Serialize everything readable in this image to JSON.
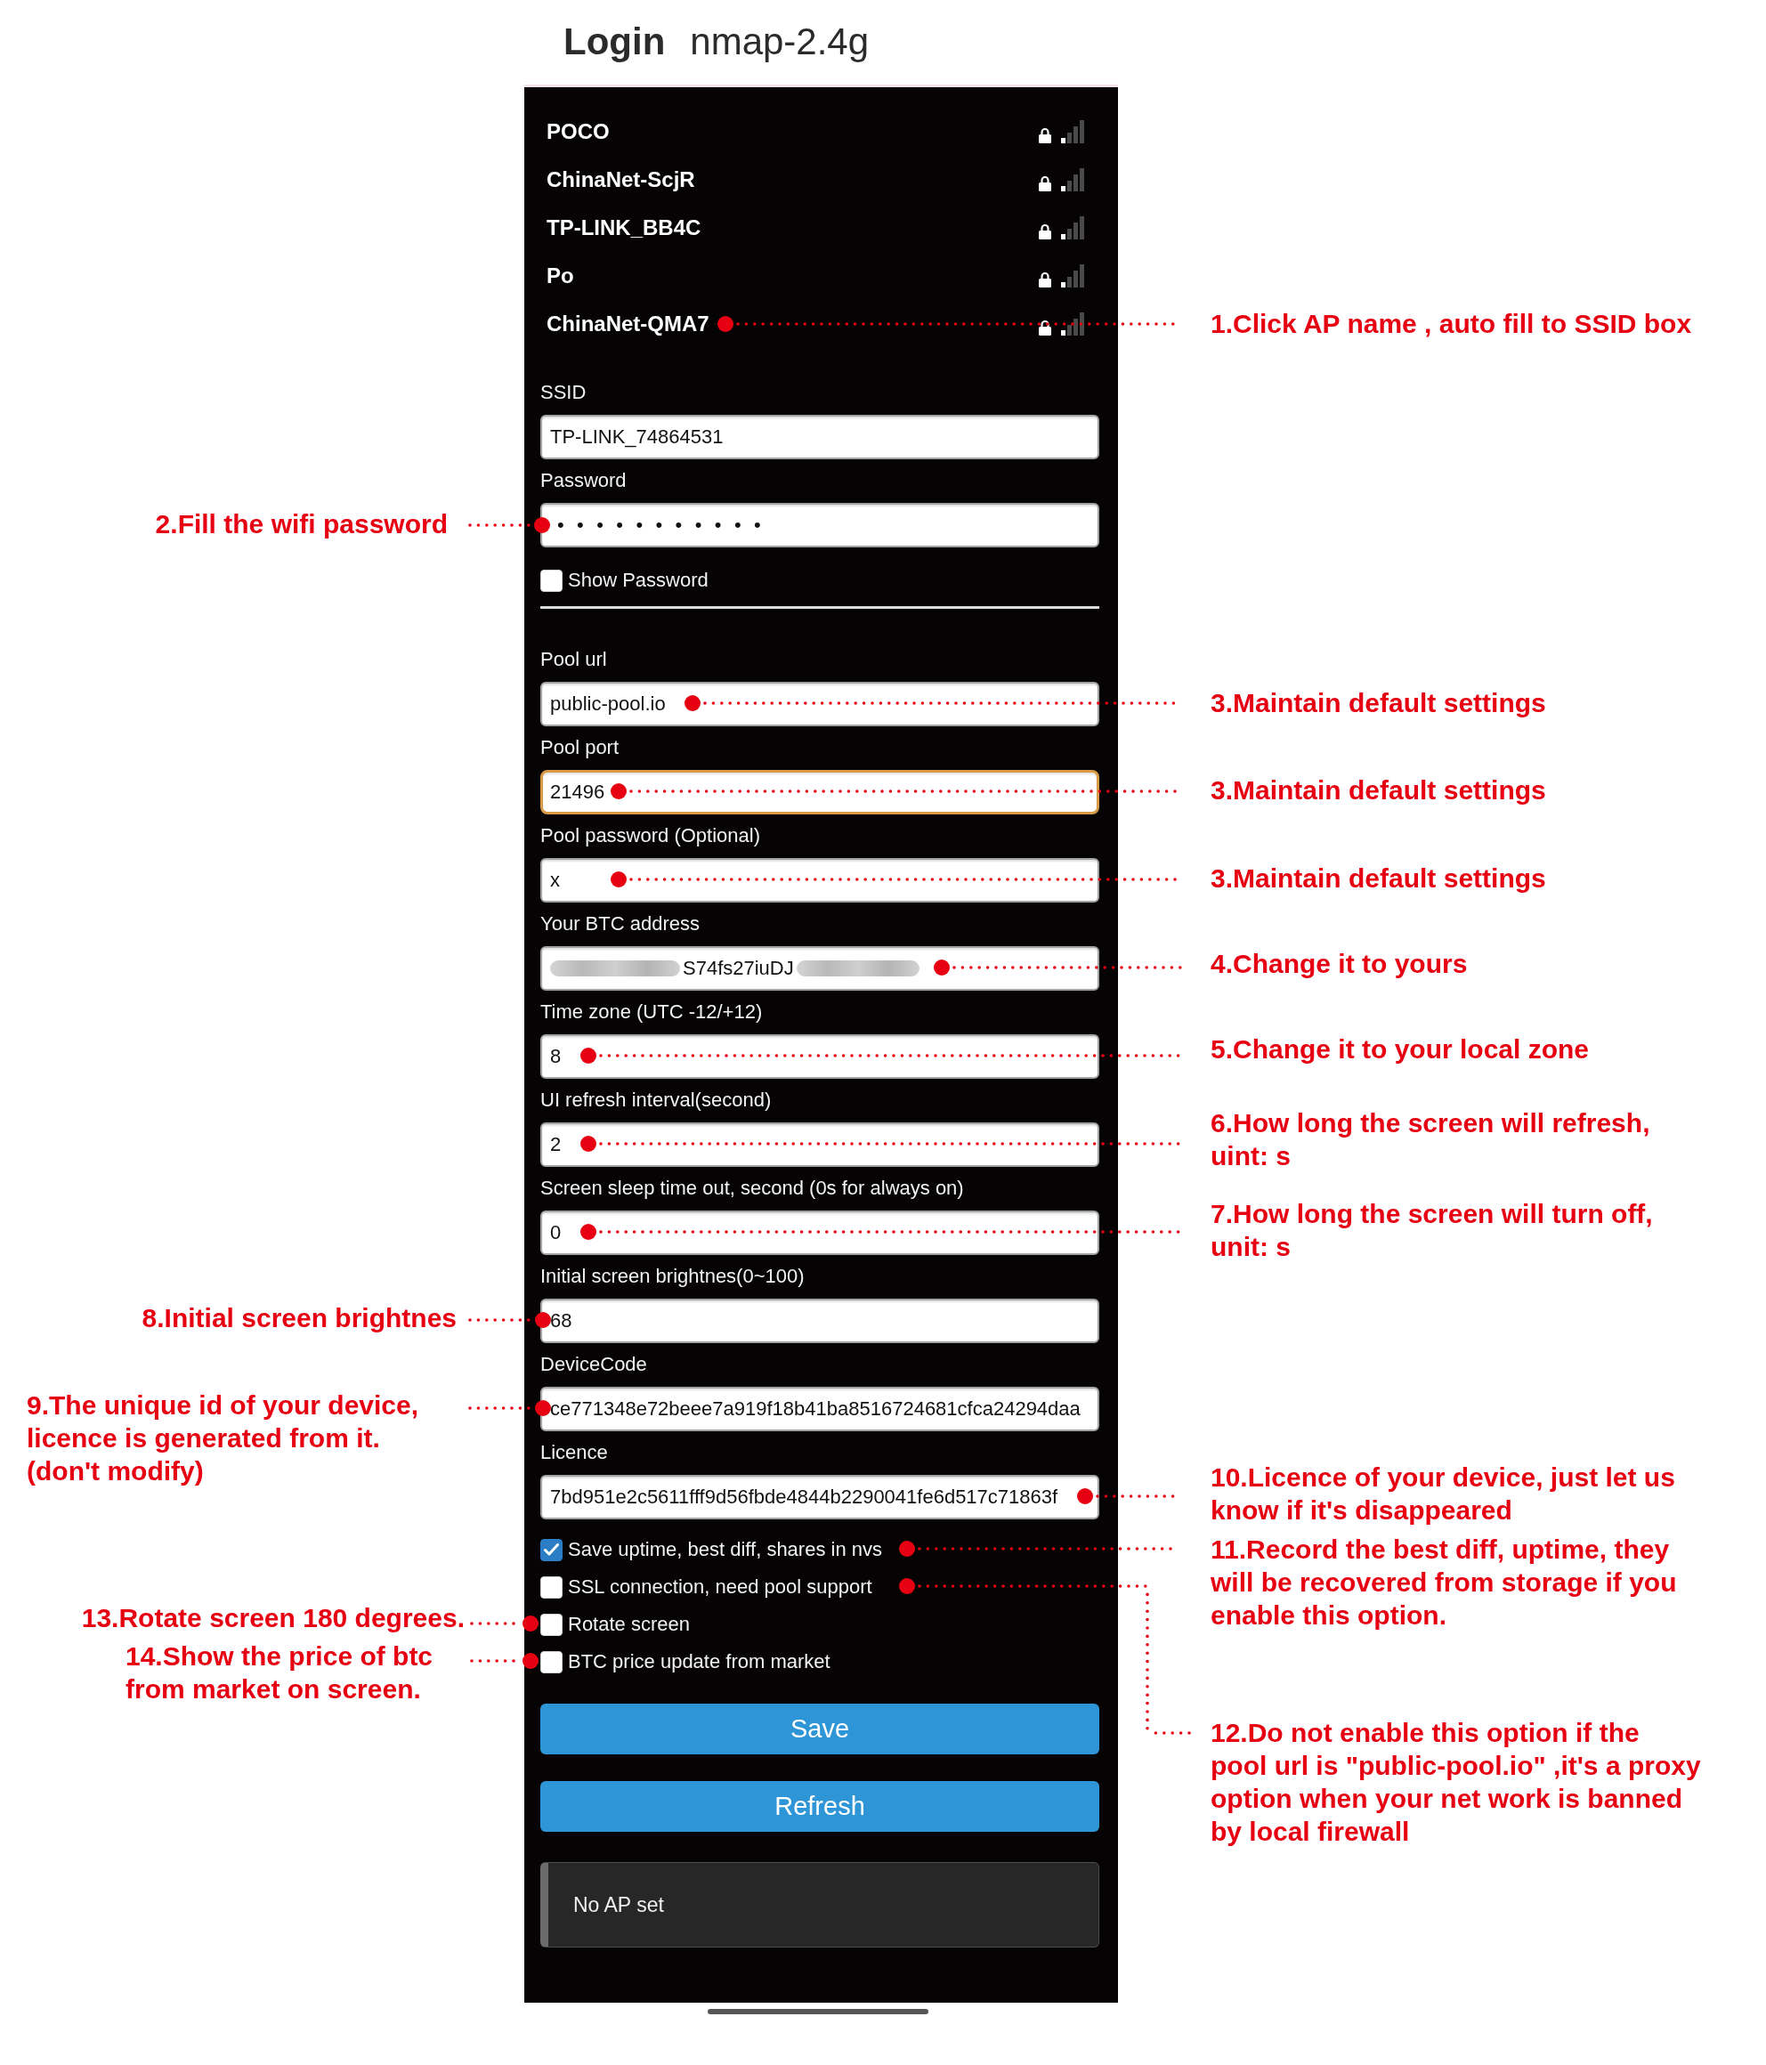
{
  "header": {
    "title": "Login",
    "subtitle": "nmap-2.4g"
  },
  "networks": [
    {
      "name": "POCO",
      "secured": true
    },
    {
      "name": "ChinaNet-ScjR",
      "secured": true
    },
    {
      "name": "TP-LINK_BB4C",
      "secured": true
    },
    {
      "name": "Po",
      "secured": true
    },
    {
      "name": "ChinaNet-QMA7",
      "secured": true
    }
  ],
  "wifi_fields": [
    {
      "label": "SSID",
      "kind": "text",
      "value": "TP-LINK_74864531",
      "focused": false
    },
    {
      "label": "Password",
      "kind": "password",
      "value": "•••••••••••",
      "focused": false
    }
  ],
  "show_password": {
    "label": "Show Password",
    "checked": false
  },
  "settings_fields": [
    {
      "label": "Pool url",
      "kind": "text",
      "value": "public-pool.io",
      "focused": false
    },
    {
      "label": "Pool port",
      "kind": "text",
      "value": "21496",
      "focused": true
    },
    {
      "label": "Pool password (Optional)",
      "kind": "text",
      "value": "x",
      "focused": false
    },
    {
      "label": "Your BTC address",
      "kind": "blurred",
      "value": "S74fs27iuDJ",
      "focused": false
    },
    {
      "label": "Time zone (UTC -12/+12)",
      "kind": "text",
      "value": "8",
      "focused": false
    },
    {
      "label": "UI refresh interval(second)",
      "kind": "text",
      "value": "2",
      "focused": false
    },
    {
      "label": "Screen sleep time out, second (0s for always on)",
      "kind": "text",
      "value": "0",
      "focused": false
    },
    {
      "label": "Initial screen brightnes(0~100)",
      "kind": "text",
      "value": "68",
      "focused": false
    },
    {
      "label": "DeviceCode",
      "kind": "text",
      "value": "ce771348e72beee7a919f18b41ba8516724681cfca24294daa",
      "focused": false
    },
    {
      "label": "Licence",
      "kind": "text",
      "value": "7bd951e2c5611fff9d56fbde4844b2290041fe6d517c71863f",
      "focused": false
    }
  ],
  "options": [
    {
      "label": "Save uptime, best diff, shares in nvs",
      "checked": true
    },
    {
      "label": "SSL connection, need pool support",
      "checked": false
    },
    {
      "label": "Rotate screen",
      "checked": false
    },
    {
      "label": "BTC price update from market",
      "checked": false
    }
  ],
  "buttons": [
    "Save",
    "Refresh"
  ],
  "status": "No AP set",
  "annotations": [
    "1.Click AP name , auto fill to SSID box",
    "2.Fill the wifi password",
    "3.Maintain default settings",
    "3.Maintain default settings",
    "3.Maintain default settings",
    "4.Change it to yours",
    "5.Change it to your local zone",
    "6.How long the screen will refresh,\nuint: s",
    "7.How long the screen will turn off,\nunit: s",
    "8.Initial screen brightnes",
    "9.The unique id of your device,\nlicence is generated from it.\n(don't modify)",
    "10.Licence of your device, just let us\nknow if it's disappeared",
    "11.Record the best diff, uptime, they\nwill be recovered from storage if you\nenable this option.",
    "12.Do not enable this option if the\npool url is \"public-pool.io\" ,it's a proxy\noption when your net work is banned\nby local firewall",
    "13.Rotate screen 180 degrees.",
    "14.Show the price of btc\nfrom market on screen."
  ]
}
